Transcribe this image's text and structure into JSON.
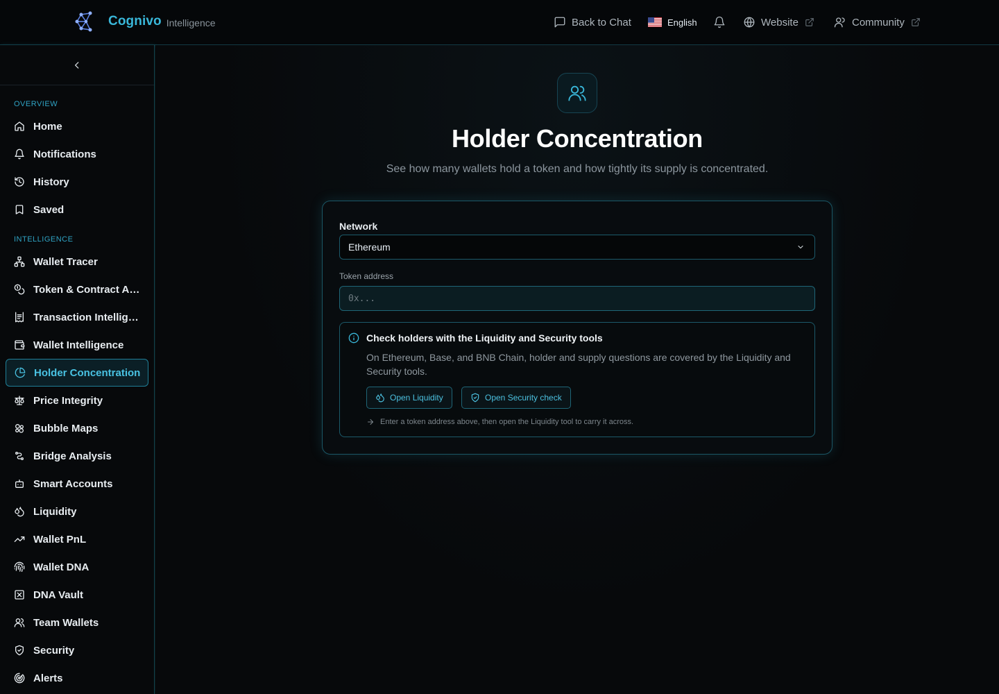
{
  "header": {
    "brand_name": "Cognivo",
    "brand_sub": "Intelligence",
    "back_to_chat": "Back to Chat",
    "language": "English",
    "website": "Website",
    "community": "Community"
  },
  "sidebar": {
    "sections": [
      {
        "label": "OVERVIEW",
        "items": [
          {
            "label": "Home",
            "icon": "home-icon"
          },
          {
            "label": "Notifications",
            "icon": "bell-icon"
          },
          {
            "label": "History",
            "icon": "history-icon"
          },
          {
            "label": "Saved",
            "icon": "bookmark-icon"
          }
        ]
      },
      {
        "label": "INTELLIGENCE",
        "items": [
          {
            "label": "Wallet Tracer",
            "icon": "network-icon"
          },
          {
            "label": "Token & Contract Analysis",
            "icon": "coins-icon"
          },
          {
            "label": "Transaction Intelligence",
            "icon": "receipt-icon"
          },
          {
            "label": "Wallet Intelligence",
            "icon": "wallet-icon"
          },
          {
            "label": "Holder Concentration",
            "icon": "pie-chart-icon",
            "active": true
          },
          {
            "label": "Price Integrity",
            "icon": "scale-icon"
          },
          {
            "label": "Bubble Maps",
            "icon": "bubbles-icon"
          },
          {
            "label": "Bridge Analysis",
            "icon": "bridge-icon"
          },
          {
            "label": "Smart Accounts",
            "icon": "bot-icon"
          },
          {
            "label": "Liquidity",
            "icon": "droplets-icon"
          },
          {
            "label": "Wallet PnL",
            "icon": "trending-up-icon"
          },
          {
            "label": "Wallet DNA",
            "icon": "fingerprint-icon"
          },
          {
            "label": "DNA Vault",
            "icon": "vault-icon"
          },
          {
            "label": "Team Wallets",
            "icon": "users-icon"
          },
          {
            "label": "Security",
            "icon": "shield-icon"
          },
          {
            "label": "Alerts",
            "icon": "radar-icon"
          }
        ]
      }
    ]
  },
  "main": {
    "title": "Holder Concentration",
    "subtitle": "See how many wallets hold a token and how tightly its supply is concentrated.",
    "network_label": "Network",
    "network_value": "Ethereum",
    "token_label": "Token address",
    "token_placeholder": "0x...",
    "notice": {
      "title": "Check holders with the Liquidity and Security tools",
      "body": "On Ethereum, Base, and BNB Chain, holder and supply questions are covered by the Liquidity and Security tools.",
      "btn_liquidity": "Open Liquidity",
      "btn_security": "Open Security check",
      "hint": "Enter a token address above, then open the Liquidity tool to carry it across."
    }
  },
  "colors": {
    "accent": "#39b7d9",
    "background": "#07090b",
    "border": "#1c5a6a"
  }
}
